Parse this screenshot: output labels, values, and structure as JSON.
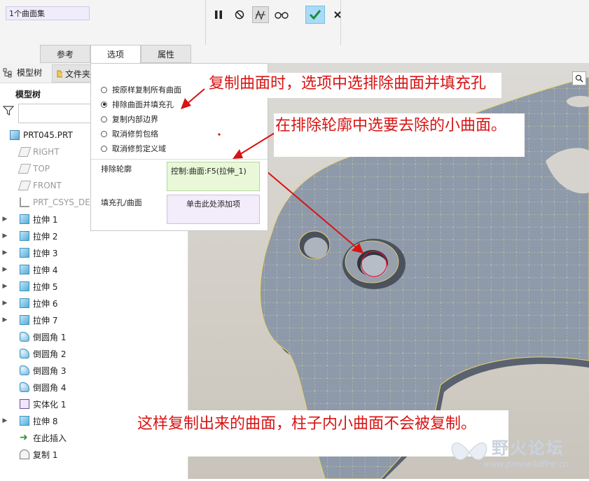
{
  "collector": {
    "value": "1个曲面集"
  },
  "dashboard": {
    "tabs": [
      {
        "label": "参考"
      },
      {
        "label": "选项"
      },
      {
        "label": "属性"
      }
    ]
  },
  "toolbar": {
    "pause_icon": "pause-icon",
    "no_preview_icon": "no-preview-icon",
    "geometry_preview_icon": "geometry-preview-icon",
    "glasses_icon": "glasses-icon",
    "ok_icon": "check-icon",
    "cancel_icon": "close-icon"
  },
  "tree_panel": {
    "tabs": [
      {
        "label": "模型树"
      },
      {
        "label": "文件夹"
      }
    ],
    "header": "模型树",
    "items": [
      {
        "label": "PRT045.PRT"
      },
      {
        "label": "RIGHT"
      },
      {
        "label": "TOP"
      },
      {
        "label": "FRONT"
      },
      {
        "label": "PRT_CSYS_DEF"
      },
      {
        "label": "拉伸 1"
      },
      {
        "label": "拉伸 2"
      },
      {
        "label": "拉伸 3"
      },
      {
        "label": "拉伸 4"
      },
      {
        "label": "拉伸 5"
      },
      {
        "label": "拉伸 6"
      },
      {
        "label": "拉伸 7"
      },
      {
        "label": "倒圆角 1"
      },
      {
        "label": "倒圆角 2"
      },
      {
        "label": "倒圆角 3"
      },
      {
        "label": "倒圆角 4"
      },
      {
        "label": "实体化 1"
      },
      {
        "label": "拉伸 8"
      },
      {
        "label": "在此插入"
      },
      {
        "label": "复制 1"
      }
    ]
  },
  "options_panel": {
    "radios": [
      {
        "label": "按原样复制所有曲面",
        "selected": false
      },
      {
        "label": "排除曲面并填充孔",
        "selected": true
      },
      {
        "label": "复制内部边界",
        "selected": false
      },
      {
        "label": "取消修剪包络",
        "selected": false
      },
      {
        "label": "取消修剪定义域",
        "selected": false
      }
    ],
    "exclude_label": "排除轮廓",
    "exclude_value": "控制:曲面:F5(拉伸_1)",
    "fill_label": "填充孔/曲面",
    "fill_value": "单击此处添加项",
    "exclude_color": "#e8f8d8",
    "fill_color": "#f2ecfb"
  },
  "annotations": {
    "callout1": "复制曲面时，选项中选排除曲面并填充孔",
    "callout2": "在排除轮廓中选要去除的小曲面。",
    "callout3": "这样复制出来的曲面，柱子内小曲面不会被复制。",
    "color": "#d81313"
  },
  "watermark": {
    "title": "野火论坛",
    "url": "www.proewildfire.cn"
  }
}
